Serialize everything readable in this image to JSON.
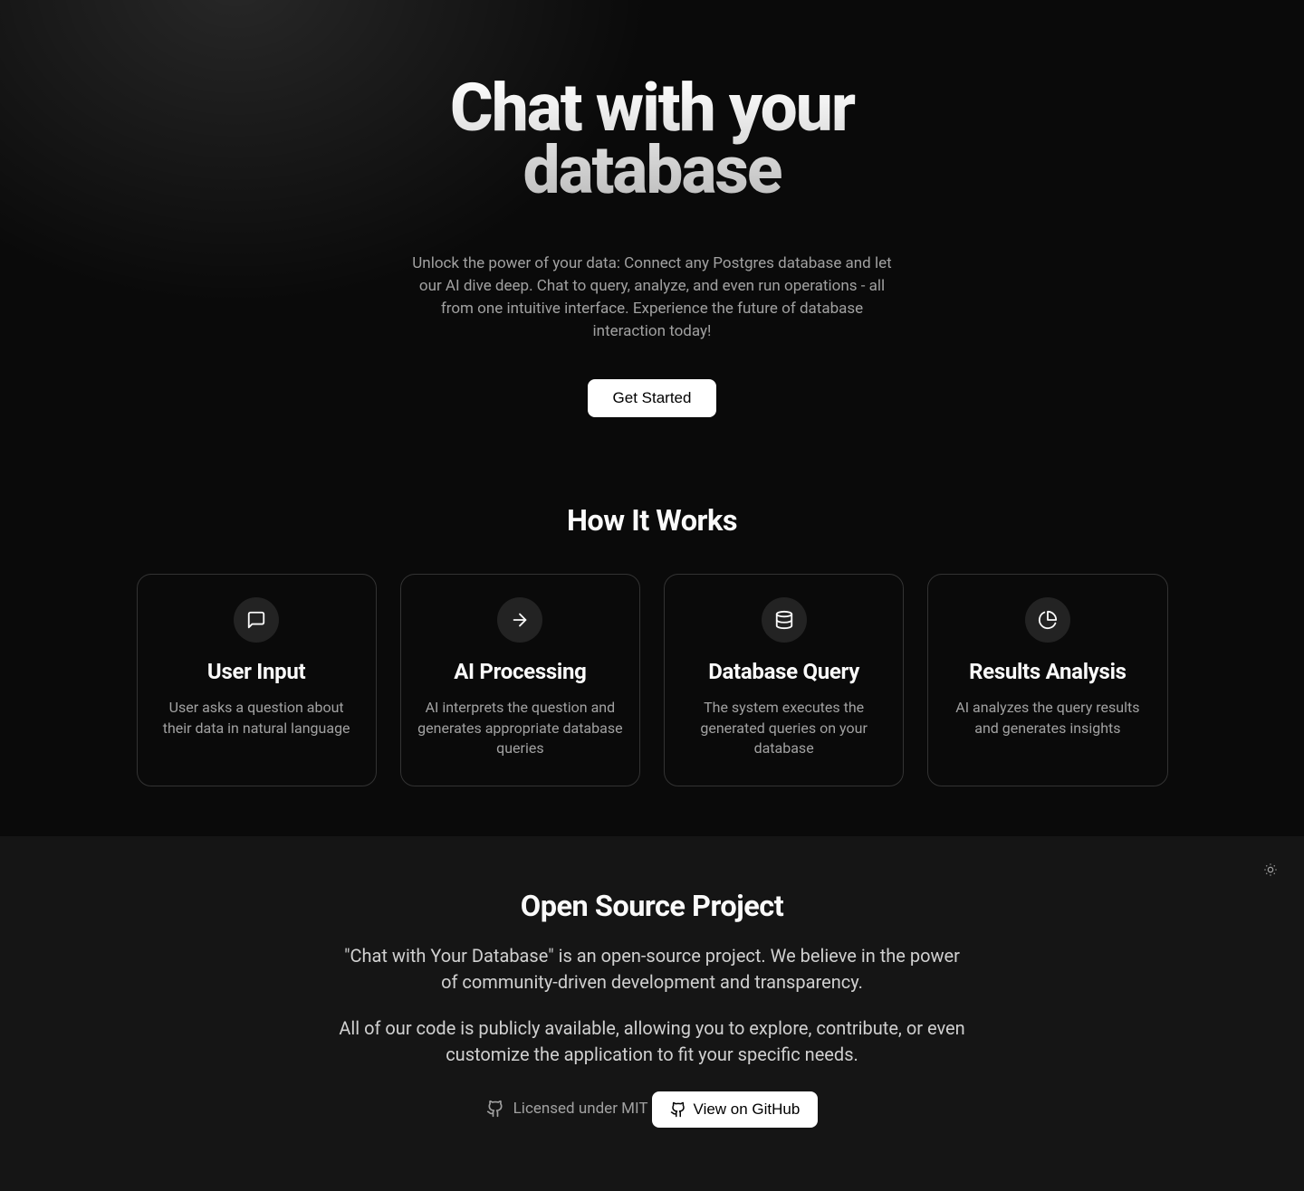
{
  "hero": {
    "title": "Chat with your database",
    "subtitle": "Unlock the power of your data: Connect any Postgres database and let our AI dive deep. Chat to query, analyze, and even run operations - all from one intuitive interface. Experience the future of database interaction today!",
    "cta": "Get Started"
  },
  "how": {
    "heading": "How It Works",
    "steps": [
      {
        "title": "User Input",
        "desc": "User asks a question about their data in natural language",
        "icon": "message-icon"
      },
      {
        "title": "AI Processing",
        "desc": "AI interprets the question and generates appropriate database queries",
        "icon": "arrow-right-icon"
      },
      {
        "title": "Database Query",
        "desc": "The system executes the generated queries on your database",
        "icon": "database-icon"
      },
      {
        "title": "Results Analysis",
        "desc": "AI analyzes the query results and generates insights",
        "icon": "pie-chart-icon"
      }
    ]
  },
  "oss": {
    "heading": "Open Source Project",
    "p1": "\"Chat with Your Database\" is an open-source project. We believe in the power of community-driven development and transparency.",
    "p2": "All of our code is publicly available, allowing you to explore, contribute, or even customize the application to fit your specific needs.",
    "license": "Licensed under MIT",
    "github_label": "View on GitHub"
  }
}
